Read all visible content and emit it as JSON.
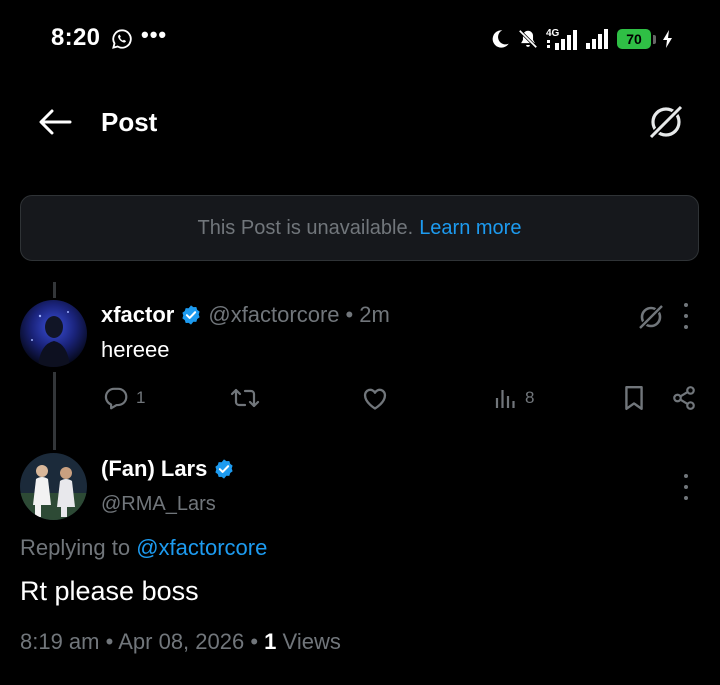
{
  "status_bar": {
    "time": "8:20",
    "more": "•••",
    "network_label": "4G",
    "battery": "70"
  },
  "header": {
    "title": "Post"
  },
  "banner": {
    "text": "This Post is unavailable.",
    "link": "Learn more"
  },
  "tweet": {
    "name": "xfactor",
    "handle": "@xfactorcore",
    "separator": "•",
    "time": "2m",
    "text": "hereee",
    "actions": {
      "replies": "1",
      "views": "8"
    }
  },
  "reply": {
    "name": "(Fan) Lars",
    "handle": "@RMA_Lars",
    "replying_prefix": "Replying to",
    "replying_to": "@xfactorcore",
    "text": "Rt please boss",
    "time": "8:19 am",
    "date": "Apr 08, 2026",
    "separator": "•",
    "views_count": "1",
    "views_label": "Views"
  },
  "colors": {
    "accent": "#1d9bf0",
    "muted": "#71767b",
    "background": "#000000",
    "battery": "#2fbf45"
  },
  "icons": [
    "whatsapp-icon",
    "moon-icon",
    "mute-bell-icon",
    "signal-icon",
    "battery-icon",
    "charging-icon",
    "back-arrow-icon",
    "grok-icon",
    "verified-badge-icon",
    "reply-icon",
    "retweet-icon",
    "like-icon",
    "views-icon",
    "bookmark-icon",
    "share-icon",
    "more-icon"
  ]
}
